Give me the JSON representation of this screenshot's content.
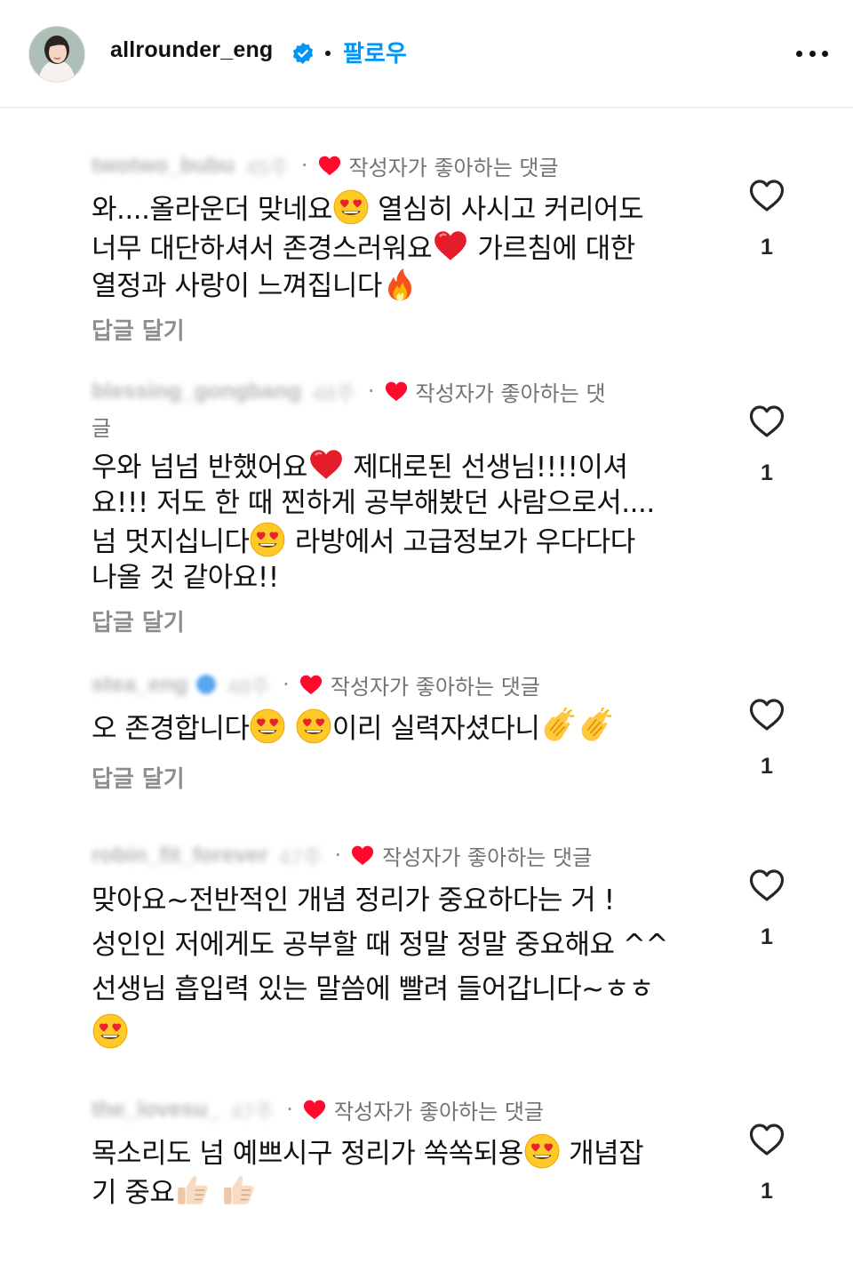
{
  "header": {
    "username": "allrounder_eng",
    "verified": true,
    "follow_label": "팔로우",
    "more_icon": "more-horizontal-icon"
  },
  "colors": {
    "accent": "#0095f6",
    "verified": "#0095f6",
    "heart_red": "#ff0033",
    "secondary_text": "#8e8e8e"
  },
  "comments": [
    {
      "liked_label": "작성자가 좋아하는 댓글",
      "lines": [
        "와....올라운더 맞네요",
        "😍",
        " 열심히 사시고 커리어도",
        "너무 대단하셔서 존경스러워요",
        "❤️",
        " 가르침에 대한",
        "열정과 사랑이 느껴집니다",
        "🔥"
      ],
      "reply_label": "답글 달기",
      "like_count": "1"
    },
    {
      "liked_label": "작성자가 좋아하는 댓",
      "liked_label_wrap": "글",
      "lines": [
        "우와 넘넘 반했어요",
        " 제대로된 선생님!!!!이셔",
        "요!!! 저도 한 때 찐하게 공부해봤던 사람으로서....",
        "넘 멋지십니다",
        " 라방에서 고급정보가 우다다다",
        "나올 것 같아요!!"
      ],
      "reply_label": "답글 달기",
      "like_count": "1"
    },
    {
      "liked_label": "작성자가 좋아하는 댓글",
      "lines": [
        "오 존경합니다",
        "이리 실력자셨다니"
      ],
      "reply_label": "답글 달기",
      "like_count": "1"
    },
    {
      "liked_label": "작성자가 좋아하는 댓글",
      "lines": [
        "맞아요~전반적인 개념 정리가 중요하다는 거 !",
        "성인인 저에게도 공부할 때 정말 정말 중요해요 ^^",
        "선생님 흡입력 있는 말씀에 빨려 들어갑니다~ㅎㅎ"
      ],
      "like_count": "1"
    },
    {
      "liked_label": "작성자가 좋아하는 댓글",
      "lines": [
        "목소리도 넘 예쁘시구 정리가 쏙쏙되용",
        " 개념잡",
        "기 중요"
      ],
      "like_count": "1"
    }
  ]
}
